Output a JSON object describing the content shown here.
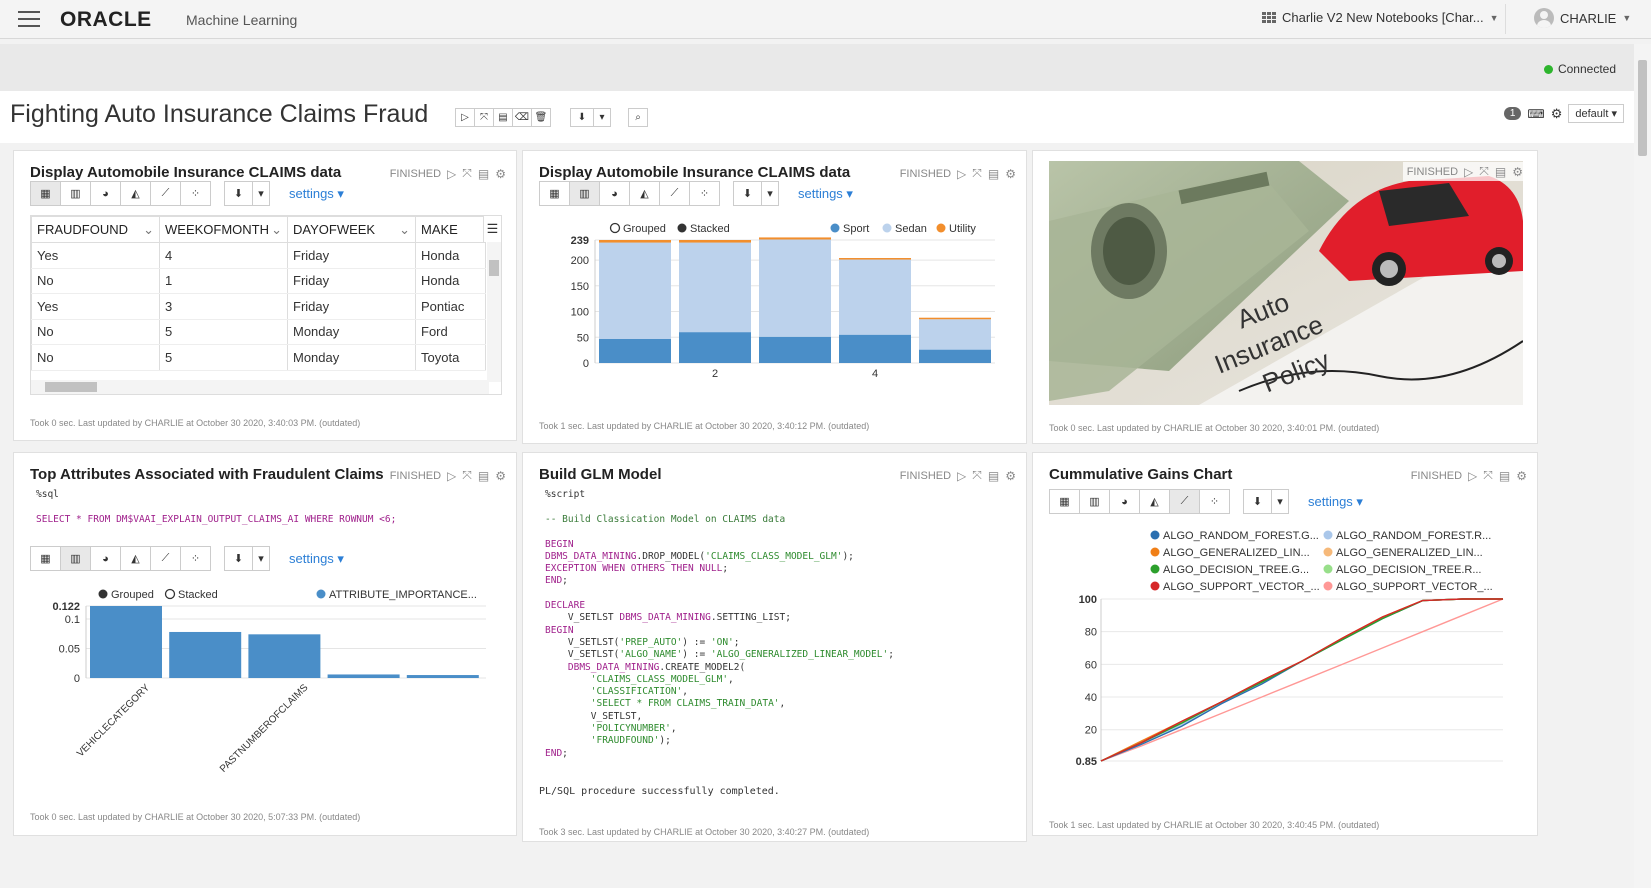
{
  "header": {
    "brand": "ORACLE",
    "product": "Machine Learning",
    "notebook_selector": "Charlie V2 New Notebooks [Char...",
    "user": "CHARLIE"
  },
  "status": {
    "connection": "Connected"
  },
  "notebook": {
    "title": "Fighting Auto Insurance Claims Fraud",
    "interpreter_badge": "1",
    "binding": "default"
  },
  "panels": [
    {
      "title": "Display Automobile Insurance CLAIMS data",
      "status": "FINISHED",
      "settings": "settings",
      "columns": [
        "FRAUDFOUND",
        "WEEKOFMONTH",
        "DAYOFWEEK",
        "MAKE"
      ],
      "rows": [
        [
          "Yes",
          "4",
          "Friday",
          "Honda"
        ],
        [
          "No",
          "1",
          "Friday",
          "Honda"
        ],
        [
          "Yes",
          "3",
          "Friday",
          "Pontiac"
        ],
        [
          "No",
          "5",
          "Monday",
          "Ford"
        ],
        [
          "No",
          "5",
          "Monday",
          "Toyota"
        ]
      ],
      "footer": "Took 0 sec. Last updated by CHARLIE at October 30 2020, 3:40:03 PM. (outdated)"
    },
    {
      "title": "Display Automobile Insurance CLAIMS data",
      "status": "FINISHED",
      "settings": "settings",
      "footer": "Took 1 sec. Last updated by CHARLIE at October 30 2020, 3:40:12 PM. (outdated)"
    },
    {
      "title": "",
      "status": "FINISHED",
      "image_text": [
        "Auto",
        "Insurance",
        "Policy"
      ],
      "footer": "Took 0 sec. Last updated by CHARLIE at October 30 2020, 3:40:01 PM. (outdated)"
    },
    {
      "title": "Top Attributes Associated with Fraudulent Claims",
      "status": "FINISHED",
      "settings": "settings",
      "code_lang": "%sql",
      "sql": "SELECT * FROM DM$VAAI_EXPLAIN_OUTPUT_CLAIMS_AI WHERE ROWNUM <6;",
      "footer": "Took 0 sec. Last updated by CHARLIE at October 30 2020, 5:07:33 PM. (outdated)"
    },
    {
      "title": "Build GLM Model",
      "status": "FINISHED",
      "code_lang": "%script",
      "output": "PL/SQL procedure successfully completed.",
      "footer": "Took 3 sec. Last updated by CHARLIE at October 30 2020, 3:40:27 PM. (outdated)"
    },
    {
      "title": "Cummulative Gains Chart",
      "status": "FINISHED",
      "settings": "settings",
      "footer": "Took 1 sec. Last updated by CHARLIE at October 30 2020, 3:40:45 PM. (outdated)"
    }
  ],
  "chart_data": [
    {
      "type": "bar",
      "stacked": true,
      "legend_toggles": [
        "Grouped",
        "Stacked"
      ],
      "categories": [
        "1",
        "2",
        "3",
        "4",
        "5"
      ],
      "x_tick_labels": [
        "2",
        "4"
      ],
      "ylim": [
        0,
        239
      ],
      "y_ticks": [
        "0",
        "50",
        "100",
        "150",
        "200",
        "239"
      ],
      "series": [
        {
          "name": "Sport",
          "color": "#4a8ec8",
          "values": [
            47,
            60,
            51,
            55,
            26
          ]
        },
        {
          "name": "Sedan",
          "color": "#bcd2ec",
          "values": [
            187,
            174,
            189,
            146,
            59
          ]
        },
        {
          "name": "Utility",
          "color": "#f28e2c",
          "values": [
            5,
            5,
            4,
            3,
            3
          ]
        }
      ]
    },
    {
      "type": "bar",
      "legend_toggles": [
        "Grouped",
        "Stacked"
      ],
      "categories": [
        "VEHICLECATEGORY",
        "",
        "PASTNUMBEROFCLAIMS",
        "",
        ""
      ],
      "ylim": [
        0,
        0.122
      ],
      "y_ticks": [
        "0",
        "0.05",
        "0.1",
        "0.122"
      ],
      "series": [
        {
          "name": "ATTRIBUTE_IMPORTANCE...",
          "color": "#4a8ec8",
          "values": [
            0.122,
            0.078,
            0.074,
            0.006,
            0.005
          ]
        }
      ]
    },
    {
      "type": "line",
      "ylim": [
        0.85,
        100
      ],
      "y_ticks": [
        "0.85",
        "20",
        "40",
        "60",
        "80",
        "100"
      ],
      "x": [
        0,
        10,
        20,
        30,
        40,
        50,
        60,
        70,
        80,
        90,
        100
      ],
      "series": [
        {
          "name": "ALGO_RANDOM_FOREST.G...",
          "color": "#2b6fb0",
          "values": [
            0.85,
            11,
            22,
            36,
            48,
            62,
            75,
            88,
            99,
            100,
            100
          ]
        },
        {
          "name": "ALGO_RANDOM_FOREST.R...",
          "color": "#aac7ea",
          "values": [
            0.85,
            11,
            23,
            36,
            49,
            62,
            75,
            88,
            99,
            100,
            100
          ]
        },
        {
          "name": "ALGO_GENERALIZED_LIN...",
          "color": "#f07f17",
          "values": [
            0.85,
            13,
            25,
            37,
            50,
            62,
            76,
            89,
            99,
            100,
            100
          ]
        },
        {
          "name": "ALGO_GENERALIZED_LIN...",
          "color": "#f6b97a",
          "values": [
            0.85,
            12,
            24,
            37,
            50,
            62,
            76,
            89,
            99,
            100,
            100
          ]
        },
        {
          "name": "ALGO_DECISION_TREE.G...",
          "color": "#2ca02c",
          "values": [
            0.85,
            12,
            24,
            37,
            49,
            62,
            75,
            88,
            99,
            100,
            100
          ]
        },
        {
          "name": "ALGO_DECISION_TREE.R...",
          "color": "#98df8a",
          "values": [
            0.85,
            12,
            24,
            37,
            49,
            62,
            75,
            88,
            99,
            100,
            100
          ]
        },
        {
          "name": "ALGO_SUPPORT_VECTOR_...",
          "color": "#d62728",
          "values": [
            0.85,
            12,
            25,
            37,
            50,
            62,
            76,
            89,
            99,
            100,
            100
          ]
        },
        {
          "name": "ALGO_SUPPORT_VECTOR_...",
          "color": "#ff9896",
          "values": [
            0.85,
            10,
            20,
            30,
            40,
            50,
            60,
            70,
            80,
            90,
            100
          ]
        }
      ]
    }
  ]
}
